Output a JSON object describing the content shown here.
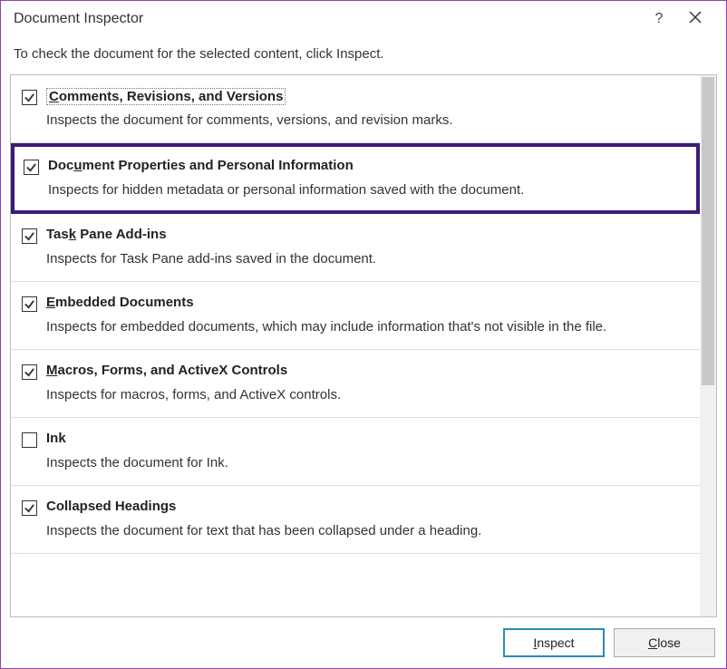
{
  "titlebar": {
    "title": "Document Inspector",
    "help_label": "?"
  },
  "instruction": "To check the document for the selected content, click Inspect.",
  "items": [
    {
      "checked": true,
      "title_pre": "",
      "title_u": "C",
      "title_post": "omments, Revisions, and Versions",
      "dotted": true,
      "desc": "Inspects the document for comments, versions, and revision marks."
    },
    {
      "checked": true,
      "title_pre": "Doc",
      "title_u": "u",
      "title_post": "ment Properties and Personal Information",
      "highlighted": true,
      "desc": "Inspects for hidden metadata or personal information saved with the document."
    },
    {
      "checked": true,
      "title_pre": "Tas",
      "title_u": "k",
      "title_post": " Pane Add-ins",
      "desc": "Inspects for Task Pane add-ins saved in the document."
    },
    {
      "checked": true,
      "title_pre": "",
      "title_u": "E",
      "title_post": "mbedded Documents",
      "desc": "Inspects for embedded documents, which may include information that's not visible in the file."
    },
    {
      "checked": true,
      "title_pre": "",
      "title_u": "M",
      "title_post": "acros, Forms, and ActiveX Controls",
      "desc": "Inspects for macros, forms, and ActiveX controls."
    },
    {
      "checked": false,
      "title_pre": "Ink",
      "title_u": "",
      "title_post": "",
      "desc": "Inspects the document for Ink."
    },
    {
      "checked": true,
      "title_pre": "Collapsed Headings",
      "title_u": "",
      "title_post": "",
      "desc": "Inspects the document for text that has been collapsed under a heading."
    }
  ],
  "footer": {
    "inspect_pre": "",
    "inspect_u": "I",
    "inspect_post": "nspect",
    "close_pre": "",
    "close_u": "C",
    "close_post": "lose"
  }
}
